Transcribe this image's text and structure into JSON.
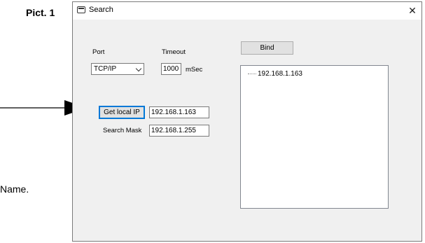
{
  "document": {
    "pict_label": "Pict. 1",
    "trailing_text": "Name."
  },
  "window": {
    "title": "Search",
    "close_glyph": "✕",
    "port": {
      "label": "Port",
      "selected": "TCP/IP"
    },
    "timeout": {
      "label": "Timeout",
      "value": "1000",
      "unit": "mSec"
    },
    "bind_button": "Bind",
    "get_local_ip_button": "Get local IP",
    "local_ip_value": "192.168.1.163",
    "search_mask": {
      "label": "Search Mask",
      "value": "192.168.1.255"
    },
    "tree": {
      "items": [
        "192.168.1.163"
      ]
    }
  },
  "icons": [
    "app-window-icon",
    "close-icon",
    "chevron-down-icon",
    "arrow-icon"
  ]
}
